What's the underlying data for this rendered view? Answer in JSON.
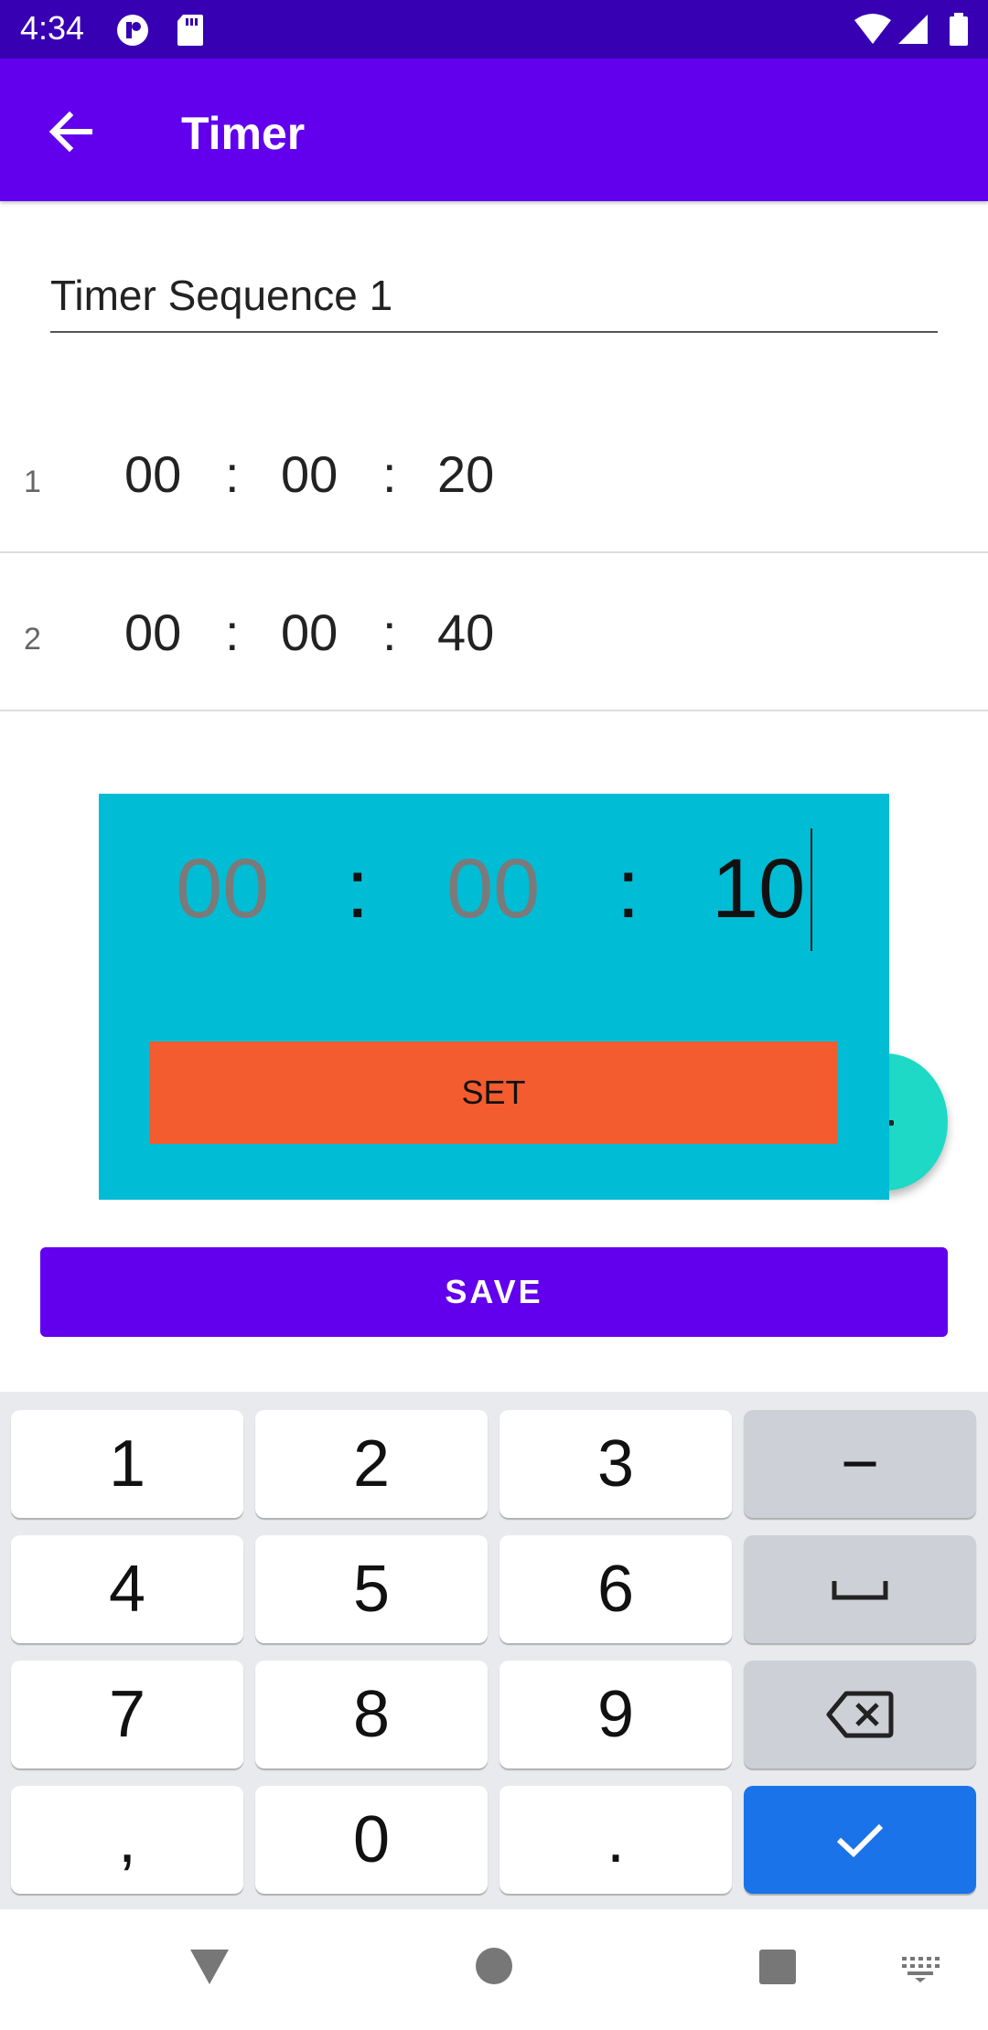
{
  "status": {
    "time": "4:34"
  },
  "appbar": {
    "title": "Timer",
    "back_icon": "arrow-left-icon"
  },
  "sequence": {
    "name": "Timer Sequence 1"
  },
  "timers": [
    {
      "index": "1",
      "hh": "00",
      "mm": "00",
      "ss": "20"
    },
    {
      "index": "2",
      "hh": "00",
      "mm": "00",
      "ss": "40"
    }
  ],
  "dialog": {
    "hh": "00",
    "mm": "00",
    "ss": "10",
    "colon": ":",
    "set_label": "SET"
  },
  "actions": {
    "save_label": "SAVE"
  },
  "keyboard": {
    "rows": [
      [
        "1",
        "2",
        "3",
        "−"
      ],
      [
        "4",
        "5",
        "6",
        "space"
      ],
      [
        "7",
        "8",
        "9",
        "backspace"
      ],
      [
        ",",
        "0",
        ".",
        "done"
      ]
    ]
  },
  "colors": {
    "appbar": "#6200ee",
    "statusbar": "#3700b3",
    "dialog": "#00bcd4",
    "set_button": "#f35c2f",
    "fab": "#1dd9c6",
    "done_key": "#1a73e8"
  }
}
